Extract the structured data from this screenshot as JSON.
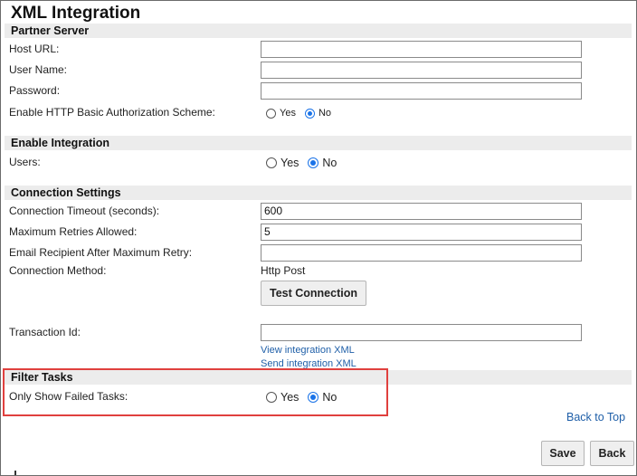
{
  "page_title": "XML Integration",
  "partner_server": {
    "heading": "Partner Server",
    "host_url_label": "Host URL:",
    "host_url_value": "",
    "user_name_label": "User Name:",
    "user_name_value": "",
    "password_label": "Password:",
    "password_value": "",
    "basic_auth_label": "Enable HTTP Basic Authorization Scheme:",
    "basic_auth_yes": "Yes",
    "basic_auth_no": "No",
    "basic_auth_selected": "No"
  },
  "enable_integration": {
    "heading": "Enable Integration",
    "users_label": "Users:",
    "users_yes": "Yes",
    "users_no": "No",
    "users_selected": "No"
  },
  "connection_settings": {
    "heading": "Connection Settings",
    "timeout_label": "Connection Timeout (seconds):",
    "timeout_value": "600",
    "retries_label": "Maximum Retries Allowed:",
    "retries_value": "5",
    "email_label": "Email Recipient After Maximum Retry:",
    "email_value": "",
    "method_label": "Connection Method:",
    "method_value": "Http Post",
    "test_button": "Test Connection",
    "transaction_label": "Transaction Id:",
    "transaction_value": "",
    "view_xml_link": "View integration XML",
    "send_xml_link": "Send integration XML"
  },
  "filter_tasks": {
    "heading": "Filter Tasks",
    "failed_label": "Only Show Failed Tasks:",
    "failed_yes": "Yes",
    "failed_no": "No",
    "failed_selected": "No"
  },
  "back_to_top": "Back to Top",
  "footer": {
    "save_label": "Save",
    "back_label": "Back"
  },
  "colors": {
    "link": "#1f5fa8",
    "radio_selected": "#1a73e8",
    "highlight_box": "#e0403e",
    "section_bg": "#ececec"
  }
}
